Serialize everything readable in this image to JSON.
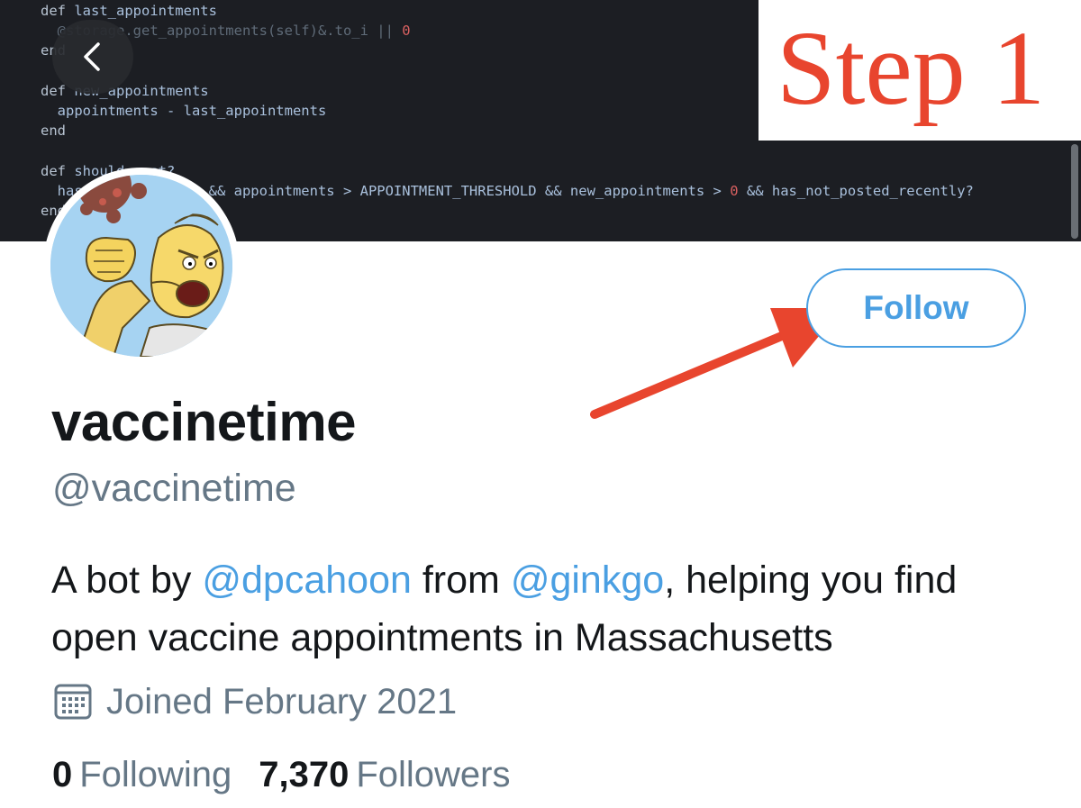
{
  "code_lines": [
    [
      {
        "t": "def ",
        "c": "kw"
      },
      {
        "t": "last_appointments",
        "c": "fn"
      }
    ],
    [
      {
        "t": "  @storage.get_appointments(self)&.to_i || ",
        "c": "dim"
      },
      {
        "t": "0",
        "c": "num"
      }
    ],
    [
      {
        "t": "end",
        "c": "kw"
      }
    ],
    [
      {
        "t": "",
        "c": "kw"
      }
    ],
    [
      {
        "t": "def ",
        "c": "kw"
      },
      {
        "t": "new_appointments",
        "c": "fn"
      }
    ],
    [
      {
        "t": "  appointments - last_appointments",
        "c": "fn"
      }
    ],
    [
      {
        "t": "end",
        "c": "kw"
      }
    ],
    [
      {
        "t": "",
        "c": "kw"
      }
    ],
    [
      {
        "t": "def ",
        "c": "kw"
      },
      {
        "t": "should_post?",
        "c": "fn"
      }
    ],
    [
      {
        "t": "  has_appointments? && appointments > ",
        "c": "fn"
      },
      {
        "t": "APPOINTMENT_THRESHOLD",
        "c": "const"
      },
      {
        "t": " && new_appointments > ",
        "c": "fn"
      },
      {
        "t": "0",
        "c": "num"
      },
      {
        "t": " && has_not_posted_recently?",
        "c": "fn"
      }
    ],
    [
      {
        "t": "end",
        "c": "kw"
      }
    ]
  ],
  "step_label": "Step 1",
  "follow_label": "Follow",
  "profile": {
    "name": "vaccinetime",
    "handle": "@vaccinetime",
    "bio": {
      "part1": "A bot by ",
      "mention1": "@dpcahoon",
      "part2": " from ",
      "mention2": "@ginkgo",
      "part3": ", helping you find open vaccine appointments in Massachusetts"
    },
    "joined": "Joined February 2021",
    "following_count": "0",
    "following_label": "Following",
    "followers_count": "7,370",
    "followers_label": "Followers"
  },
  "icons": {
    "back": "chevron-left-icon",
    "calendar": "calendar-icon",
    "annotation": "red-arrow"
  },
  "colors": {
    "link_blue": "#4a9fe2",
    "annotation_red": "#e8452e",
    "code_bg": "#1c1e23",
    "secondary_text": "#657786"
  }
}
